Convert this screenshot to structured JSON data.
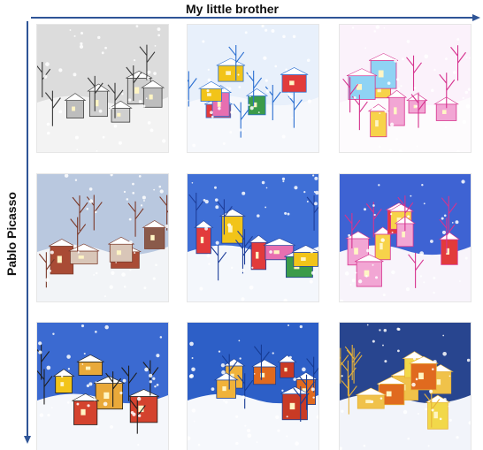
{
  "axes": {
    "top_label": "My little brother",
    "left_label": "Pablo Picasso"
  },
  "grid": {
    "rows": 3,
    "cols": 3,
    "tiles": [
      {
        "name": "sketch-snow-trees",
        "palette": {
          "sky": "#dcdcdc",
          "ground": "#f3f3f3",
          "accent": "#3a3a3a"
        },
        "houses": [
          "#cfcfcf",
          "#bdbdbd"
        ]
      },
      {
        "name": "colorful-snow-village",
        "palette": {
          "sky": "#e8f0fb",
          "ground": "#f6f8fc",
          "accent": "#2b6fd1"
        },
        "houses": [
          "#e23b3b",
          "#f2c419",
          "#3c9b4a",
          "#e76fb0"
        ]
      },
      {
        "name": "crayon-pink-houses",
        "palette": {
          "sky": "#fbf2fb",
          "ground": "#fdfbfd",
          "accent": "#d6338f"
        },
        "houses": [
          "#f2a6d4",
          "#f7d34a",
          "#8fd3f4"
        ]
      },
      {
        "name": "snowy-red-town",
        "palette": {
          "sky": "#b9c8df",
          "ground": "#f2f4f7",
          "accent": "#7b3a2a"
        },
        "houses": [
          "#a94b35",
          "#d9c6b8",
          "#8a5a4a"
        ]
      },
      {
        "name": "blue-night-village",
        "palette": {
          "sky": "#3f6fd6",
          "ground": "#f4f7fc",
          "accent": "#1f3f9a"
        },
        "houses": [
          "#e23b3b",
          "#f2c419",
          "#e76fb0",
          "#3c9b4a"
        ]
      },
      {
        "name": "snowflake-pink-village",
        "palette": {
          "sky": "#3e63d3",
          "ground": "#f8f4fb",
          "accent": "#d6338f"
        },
        "houses": [
          "#f2a6d4",
          "#f7d34a",
          "#e23b3b"
        ]
      },
      {
        "name": "cubist-yellow-houses",
        "palette": {
          "sky": "#3b6ad1",
          "ground": "#f5f7fb",
          "accent": "#1e1e1e"
        },
        "houses": [
          "#e9a93a",
          "#d4432e",
          "#f2c419"
        ]
      },
      {
        "name": "bold-orange-houses",
        "palette": {
          "sky": "#2d5fc7",
          "ground": "#f6f8fc",
          "accent": "#163c94"
        },
        "houses": [
          "#e06a1f",
          "#f0b23a",
          "#c93a25"
        ]
      },
      {
        "name": "night-snow-yellow-houses",
        "palette": {
          "sky": "#28458f",
          "ground": "#f2f4fa",
          "accent": "#e6b23a"
        },
        "houses": [
          "#f0c24a",
          "#e06a1f",
          "#f2d84a"
        ]
      }
    ]
  }
}
